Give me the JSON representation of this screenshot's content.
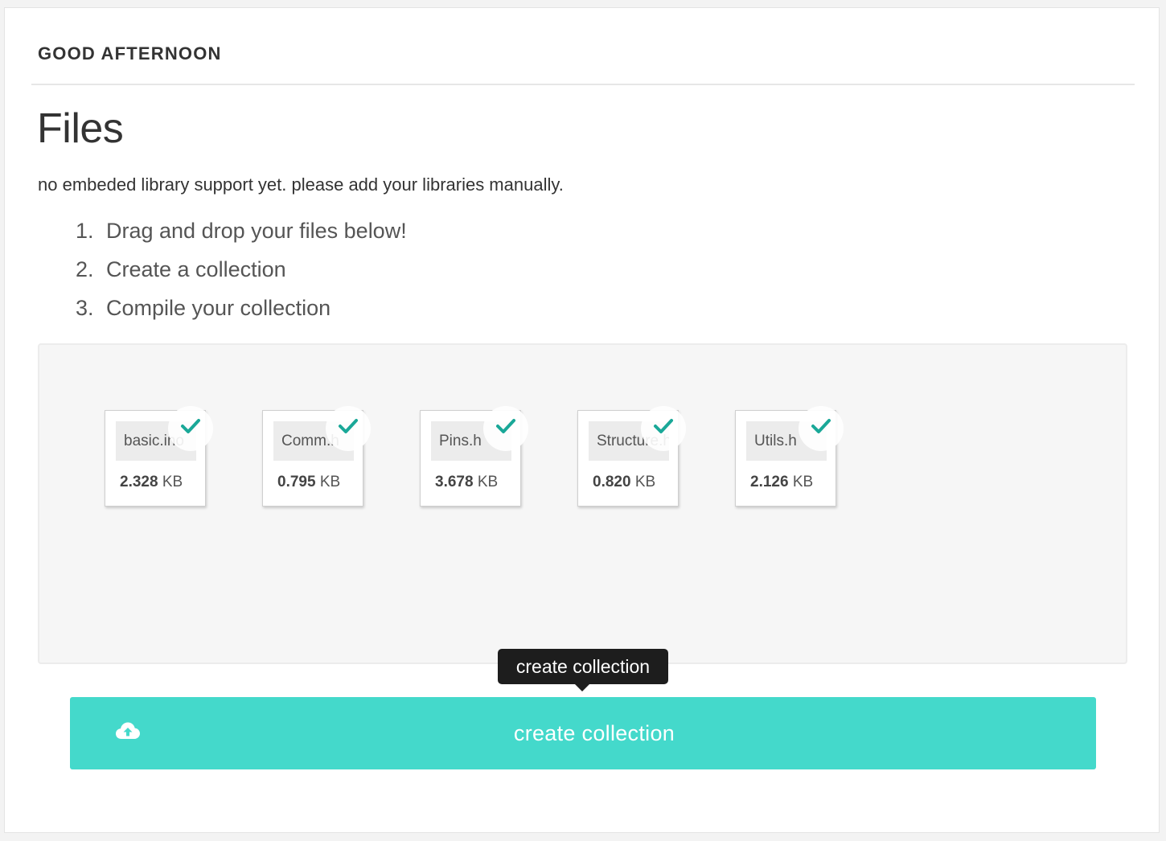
{
  "header": {
    "greeting": "GOOD AFTERNOON"
  },
  "main": {
    "title": "Files",
    "subtitle": "no embeded library support yet. please add your libraries manually.",
    "steps": [
      {
        "num": "1.",
        "text": "Drag and drop your files below!"
      },
      {
        "num": "2.",
        "text": "Create a collection"
      },
      {
        "num": "3.",
        "text": "Compile your collection"
      }
    ]
  },
  "dropzone": {
    "files": [
      {
        "name": "basic.ino",
        "size": "2.328",
        "unit": "KB",
        "status_icon": "check-icon"
      },
      {
        "name": "Comm.h",
        "size": "0.795",
        "unit": "KB",
        "status_icon": "check-icon"
      },
      {
        "name": "Pins.h",
        "size": "3.678",
        "unit": "KB",
        "status_icon": "check-icon"
      },
      {
        "name": "Structure.h",
        "size": "0.820",
        "unit": "KB",
        "status_icon": "check-icon"
      },
      {
        "name": "Utils.h",
        "size": "2.126",
        "unit": "KB",
        "status_icon": "check-icon"
      }
    ]
  },
  "tooltip": {
    "text": "create collection"
  },
  "actions": {
    "create_label": "create collection",
    "create_icon": "cloud-upload-icon"
  },
  "colors": {
    "accent": "#44d9cb",
    "check": "#1aa898",
    "tooltip_bg": "#1d1d1d"
  }
}
